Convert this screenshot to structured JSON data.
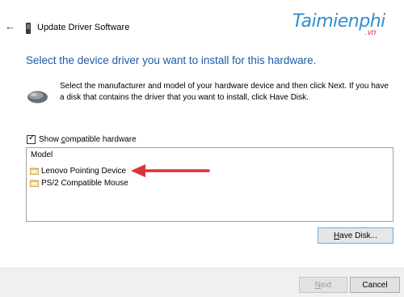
{
  "window": {
    "back_glyph": "←",
    "title": "Update Driver Software",
    "watermark": "Taimienphi",
    "watermark_sub": ".vn"
  },
  "heading": "Select the device driver you want to install for this hardware.",
  "description": "Select the manufacturer and model of your hardware device and then click Next. If you have a disk that contains the driver that you want to install, click Have Disk.",
  "compatible_checkbox": {
    "checked": true,
    "label_pre": "Show ",
    "label_accel": "c",
    "label_post": "ompatible hardware"
  },
  "model_list": {
    "header": "Model",
    "items": [
      {
        "label": "Lenovo Pointing Device",
        "selected": false
      },
      {
        "label": "PS/2 Compatible Mouse",
        "selected": false
      }
    ]
  },
  "buttons": {
    "have_disk_accel": "H",
    "have_disk_rest": "ave Disk...",
    "next_accel": "N",
    "next_rest": "ext",
    "cancel": "Cancel"
  },
  "icons": {
    "title": "device-icon",
    "hardware": "mouse-icon",
    "model_item": "driver-folder-icon",
    "annotation": "red-arrow"
  },
  "colors": {
    "heading": "#1d5aa8",
    "arrow": "#d9343a",
    "watermark": "#2f8fd0",
    "footer": "#f0f0f0",
    "have_disk_border": "#7aa8d8"
  }
}
